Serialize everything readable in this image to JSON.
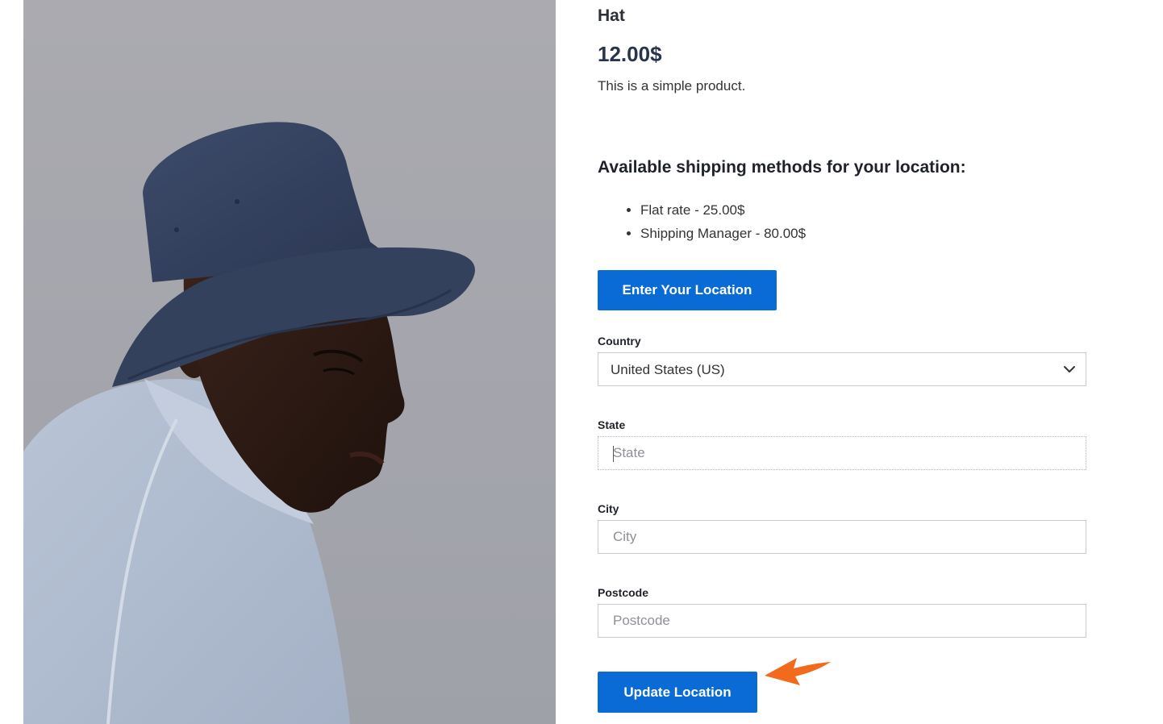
{
  "product": {
    "title": "Hat",
    "price": "12.00$",
    "description": "This is a simple product.",
    "image_icon": "product-photo-hat-model"
  },
  "shipping": {
    "heading": "Available shipping methods for your location:",
    "methods": [
      {
        "label": "Flat rate - 25.00$"
      },
      {
        "label": "Shipping Manager - 80.00$"
      }
    ]
  },
  "location_form": {
    "enter_button_label": "Enter Your Location",
    "country": {
      "label": "Country",
      "value": "United States (US)",
      "icon": "chevron-down-icon"
    },
    "state": {
      "label": "State",
      "placeholder": "State",
      "value": ""
    },
    "city": {
      "label": "City",
      "placeholder": "City",
      "value": ""
    },
    "postcode": {
      "label": "Postcode",
      "placeholder": "Postcode",
      "value": ""
    },
    "update_button_label": "Update Location"
  },
  "colors": {
    "primary_button": "#0b6bd6",
    "annotation_arrow": "#f26a1b",
    "heading_text": "#1f2329"
  }
}
